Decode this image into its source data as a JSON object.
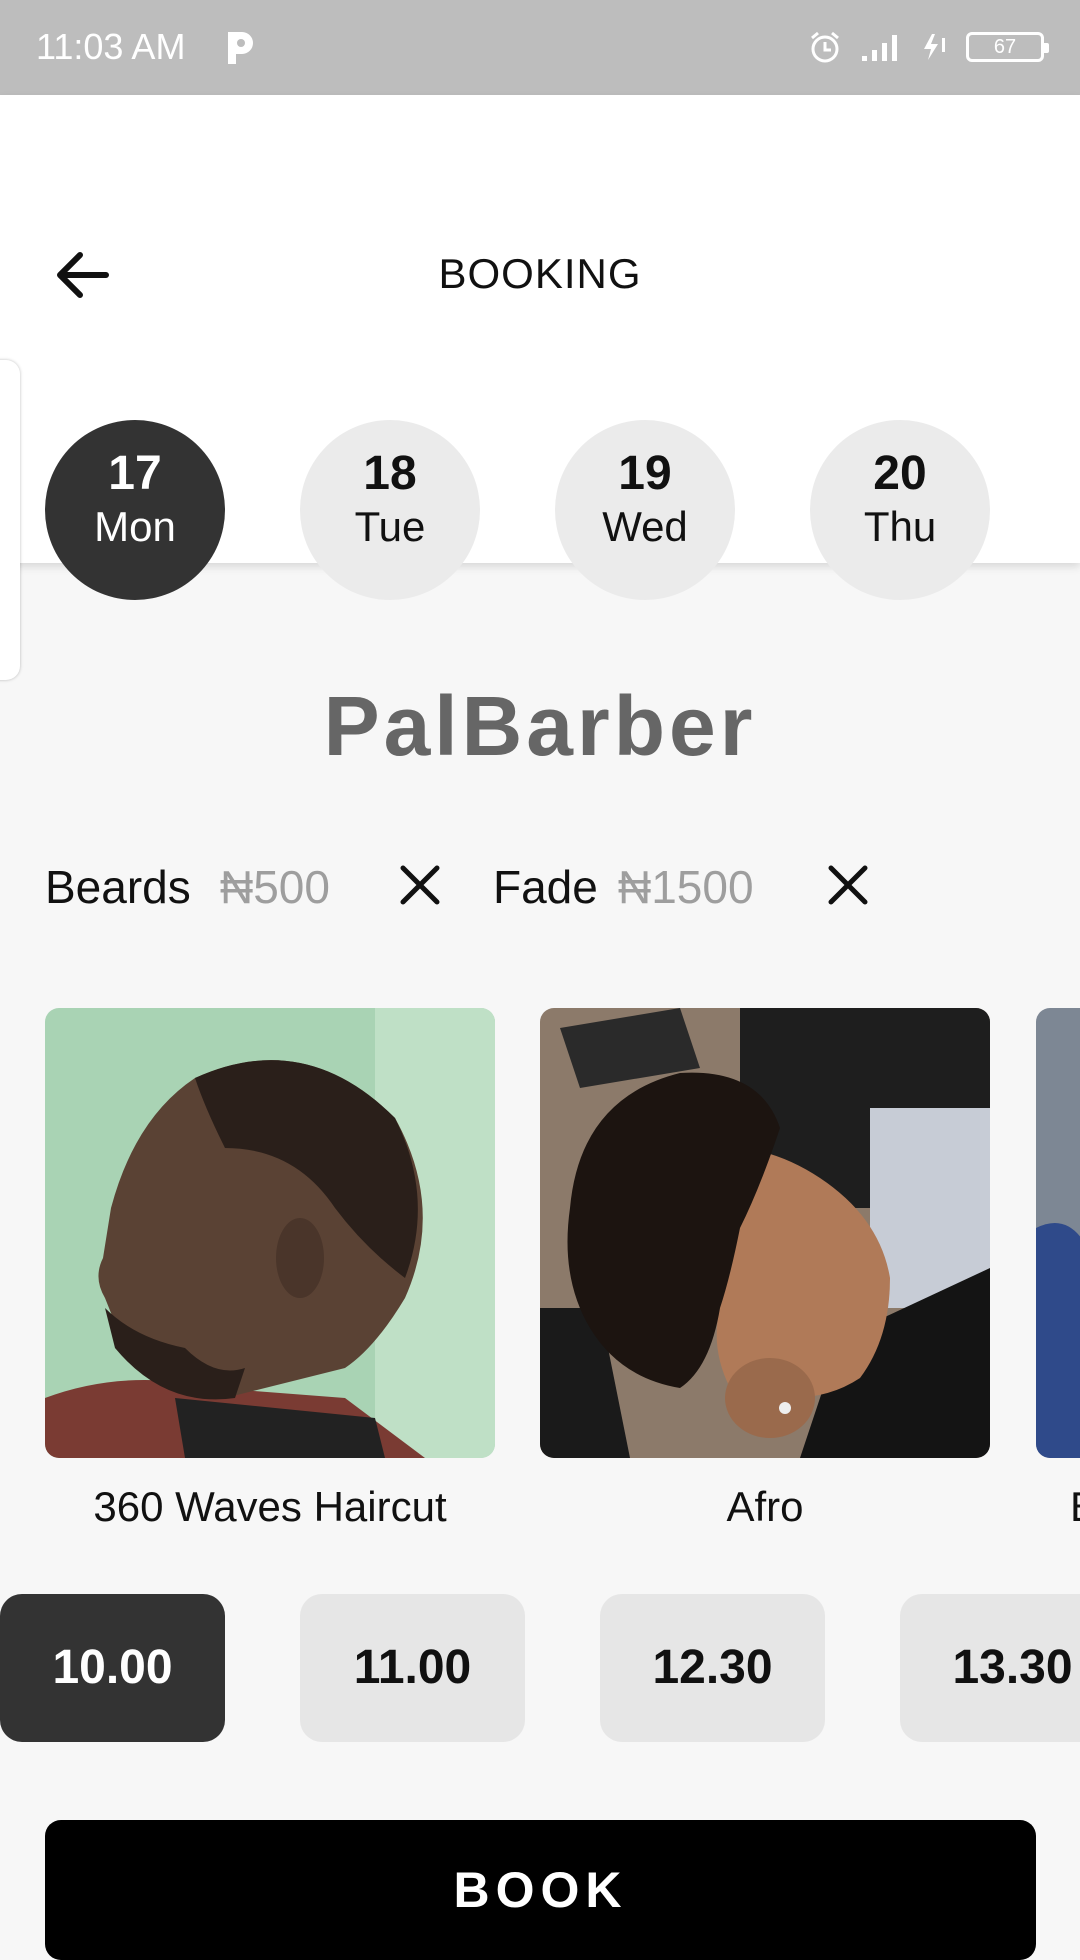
{
  "status_bar": {
    "time": "11:03 AM",
    "battery": "67"
  },
  "header": {
    "title": "BOOKING"
  },
  "days": [
    {
      "num": "17",
      "weekday": "Mon",
      "selected": true
    },
    {
      "num": "18",
      "weekday": "Tue",
      "selected": false
    },
    {
      "num": "19",
      "weekday": "Wed",
      "selected": false
    },
    {
      "num": "20",
      "weekday": "Thu",
      "selected": false
    }
  ],
  "brand": "PalBarber",
  "selected_services": [
    {
      "name": "Beards",
      "price": "₦500"
    },
    {
      "name": "Fade",
      "price": "₦1500"
    }
  ],
  "styles": [
    {
      "label": "360 Waves Haircut"
    },
    {
      "label": "Afro"
    },
    {
      "label": "B"
    }
  ],
  "time_slots": [
    {
      "label": "10.00",
      "selected": true
    },
    {
      "label": "11.00",
      "selected": false
    },
    {
      "label": "12.30",
      "selected": false
    },
    {
      "label": "13.30",
      "selected": false
    }
  ],
  "book_label": "BOOK",
  "colors": {
    "selected": "#333333",
    "unselected": "#ebebeb",
    "book": "#000000",
    "brand_text": "#666666"
  }
}
